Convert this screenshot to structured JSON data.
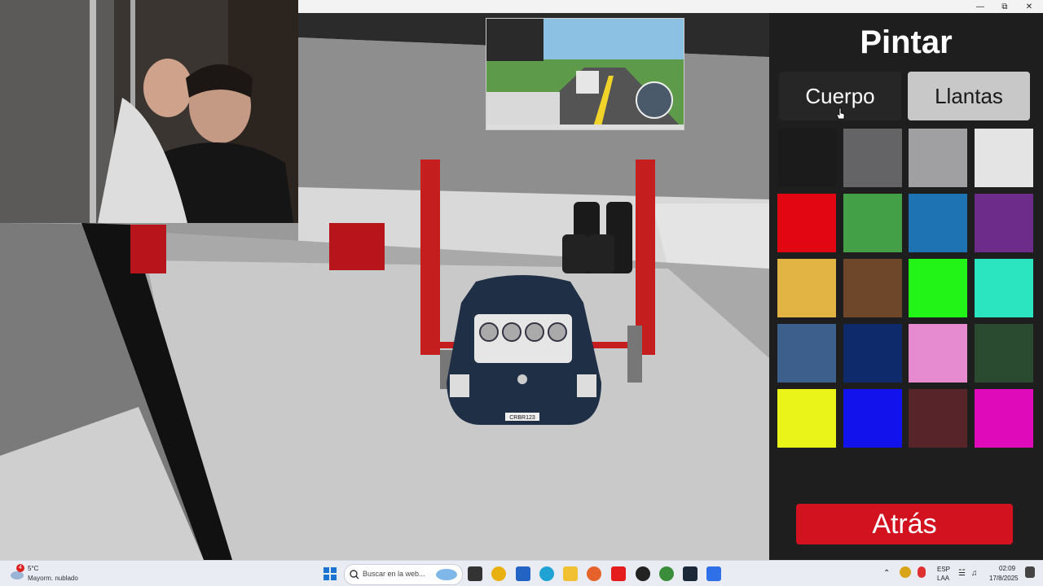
{
  "window": {
    "minimize_icon": "minimize-icon",
    "restore_icon": "restore-icon",
    "close_icon": "close-icon"
  },
  "game": {
    "license_plate": "CRBR123"
  },
  "paint_panel": {
    "title": "Pintar",
    "tabs": [
      {
        "label": "Cuerpo",
        "active": false
      },
      {
        "label": "Llantas",
        "active": true
      }
    ],
    "swatches": [
      "#1b1b1b",
      "#646366",
      "#a0a0a2",
      "#e4e4e4",
      "#e20612",
      "#43a046",
      "#1e73b3",
      "#6d2c8a",
      "#e2b443",
      "#6e472a",
      "#22f417",
      "#2ae5c0",
      "#3d5f8c",
      "#0e2a6a",
      "#e78bd0",
      "#2a4b2f",
      "#eaf419",
      "#1212ec",
      "#562429",
      "#df0bbb"
    ],
    "back_label": "Atrás",
    "accent": "#d3121f"
  },
  "taskbar": {
    "weather_temp": "5°C",
    "weather_desc": "Mayorm. nublado",
    "weather_badge": "4",
    "search_placeholder": "Buscar en la web...",
    "lang_line1": "ESP",
    "lang_line2": "LAA",
    "time": "02:09",
    "date": "17/8/2025"
  }
}
